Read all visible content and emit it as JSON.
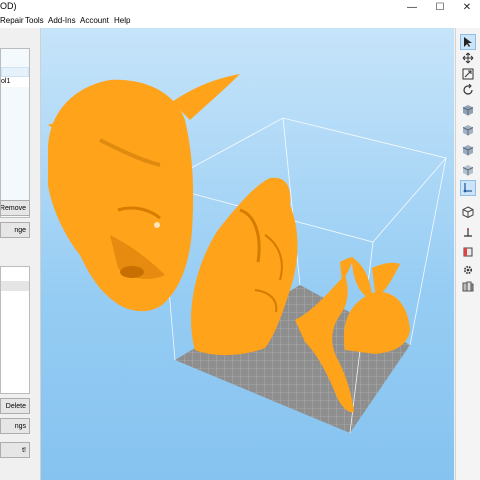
{
  "window": {
    "title_fragment": "OD)",
    "controls": [
      "—",
      "☐",
      "✕"
    ]
  },
  "menu": [
    "Repair",
    "Tools",
    "Add-Ins",
    "Account",
    "Help"
  ],
  "left_panel": {
    "object_item": "ol1",
    "remove_label": "Remove",
    "change_label": "nge",
    "delete_label": "Delete",
    "settings_label": "ngs",
    "go_label": "t!"
  },
  "toolbar": {
    "icons": [
      "pointer-icon",
      "move-icon",
      "scale-icon",
      "rotate-icon",
      "cube-view-icon",
      "cube-front-icon",
      "cube-side-icon",
      "cube-top-icon",
      "measure-icon",
      "wireframe-cube-icon",
      "axis-icon",
      "box-icon",
      "settings-gear-icon",
      "layers-icon"
    ],
    "selected": [
      "pointer-icon",
      "measure-icon"
    ]
  },
  "colors": {
    "model": "#ffa31a",
    "viewport_top": "#c6e4fa",
    "viewport_bottom": "#86c3f0",
    "build_plate": "#8e8e8e"
  }
}
